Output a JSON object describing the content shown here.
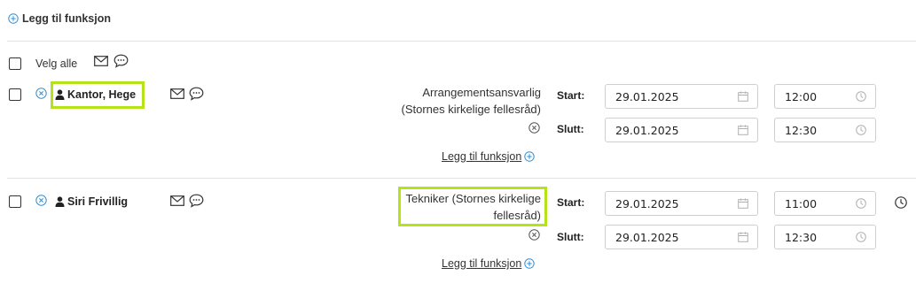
{
  "toolbar": {
    "add_function_label": "Legg til funksjon"
  },
  "select_all": {
    "label": "Velg alle"
  },
  "rows": [
    {
      "name": "Kantor, Hege",
      "role": [
        "Arrangementsansvarlig",
        "(Stornes kirkelige fellesråd)"
      ],
      "start_label": "Start:",
      "end_label": "Slutt:",
      "start_date": "29.01.2025",
      "start_time": "12:00",
      "end_date": "29.01.2025",
      "end_time": "12:30",
      "add_function_link": "Legg til funksjon"
    },
    {
      "name": "Siri Frivillig",
      "role": [
        "Tekniker (Stornes kirkelige",
        "fellesråd)"
      ],
      "start_label": "Start:",
      "end_label": "Slutt:",
      "start_date": "29.01.2025",
      "start_time": "11:00",
      "end_date": "29.01.2025",
      "end_time": "12:30",
      "add_function_link": "Legg til funksjon"
    }
  ],
  "colors": {
    "accent": "#2f8fd6",
    "highlight": "#b4e31a",
    "border": "#cfcfcf",
    "icon_gray": "#b0b0b0"
  }
}
